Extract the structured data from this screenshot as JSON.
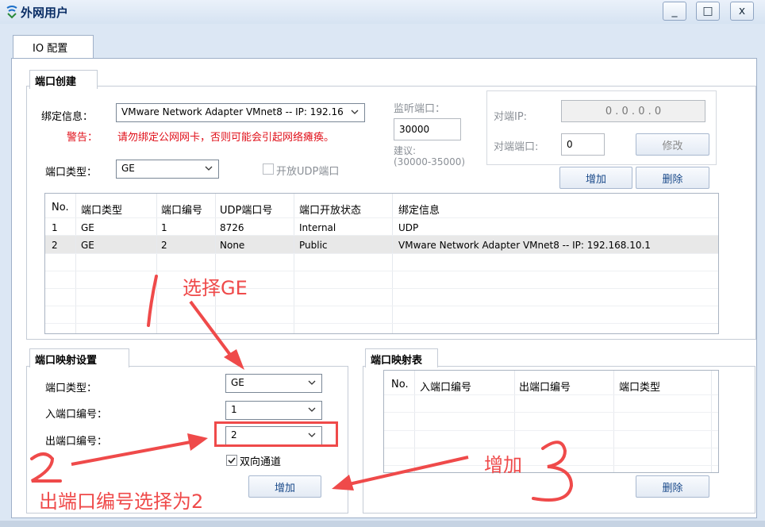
{
  "window": {
    "title": "外网用户",
    "minimize": "_",
    "maximize": "□",
    "close": "x"
  },
  "tab": {
    "label": "IO 配置"
  },
  "port_create": {
    "group_title": "端口创建",
    "bind_label": "绑定信息：",
    "bind_value": "VMware Network Adapter VMnet8 -- IP: 192.16",
    "warn_label": "警告：",
    "warn_text": "请勿绑定公网网卡，否则可能会引起网络瘫痪。",
    "type_label": "端口类型：",
    "type_value": "GE",
    "udp_label": "开放UDP端口",
    "listen_label": "监听端口：",
    "listen_value": "30000",
    "suggest_label": "建议:",
    "suggest_range": "(30000-35000)",
    "peer_ip_label": "对端IP:",
    "peer_ip_value": "0   .   0   .   0   .   0",
    "peer_port_label": "对端端口:",
    "peer_port_value": "0",
    "modify_button": "修改",
    "add_button": "增加",
    "delete_button": "删除"
  },
  "port_table": {
    "headers": [
      "No.",
      "端口类型",
      "端口编号",
      "UDP端口号",
      "端口开放状态",
      "绑定信息"
    ],
    "rows": [
      [
        "1",
        "GE",
        "1",
        "8726",
        "Internal",
        "UDP"
      ],
      [
        "2",
        "GE",
        "2",
        "None",
        "Public",
        "VMware Network Adapter VMnet8 -- IP: 192.168.10.1"
      ]
    ]
  },
  "mapping_settings": {
    "group_title": "端口映射设置",
    "type_label": "端口类型：",
    "type_value": "GE",
    "in_label": "入端口编号：",
    "in_value": "1",
    "out_label": "出端口编号：",
    "out_value": "2",
    "bidir_label": "双向通道",
    "add_button": "增加"
  },
  "mapping_table": {
    "group_title": "端口映射表",
    "headers": [
      "No.",
      "入端口编号",
      "出端口编号",
      "端口类型"
    ],
    "delete_button": "删除"
  },
  "annotations": {
    "select_ge": "选择GE",
    "step2": "2",
    "out_port_note": "出端口编号选择为2",
    "add_note": "增加",
    "step3": "3"
  },
  "colors": {
    "annotation": "#ef4a4a",
    "warning": "#e0101a",
    "title": "#0b2e66"
  }
}
